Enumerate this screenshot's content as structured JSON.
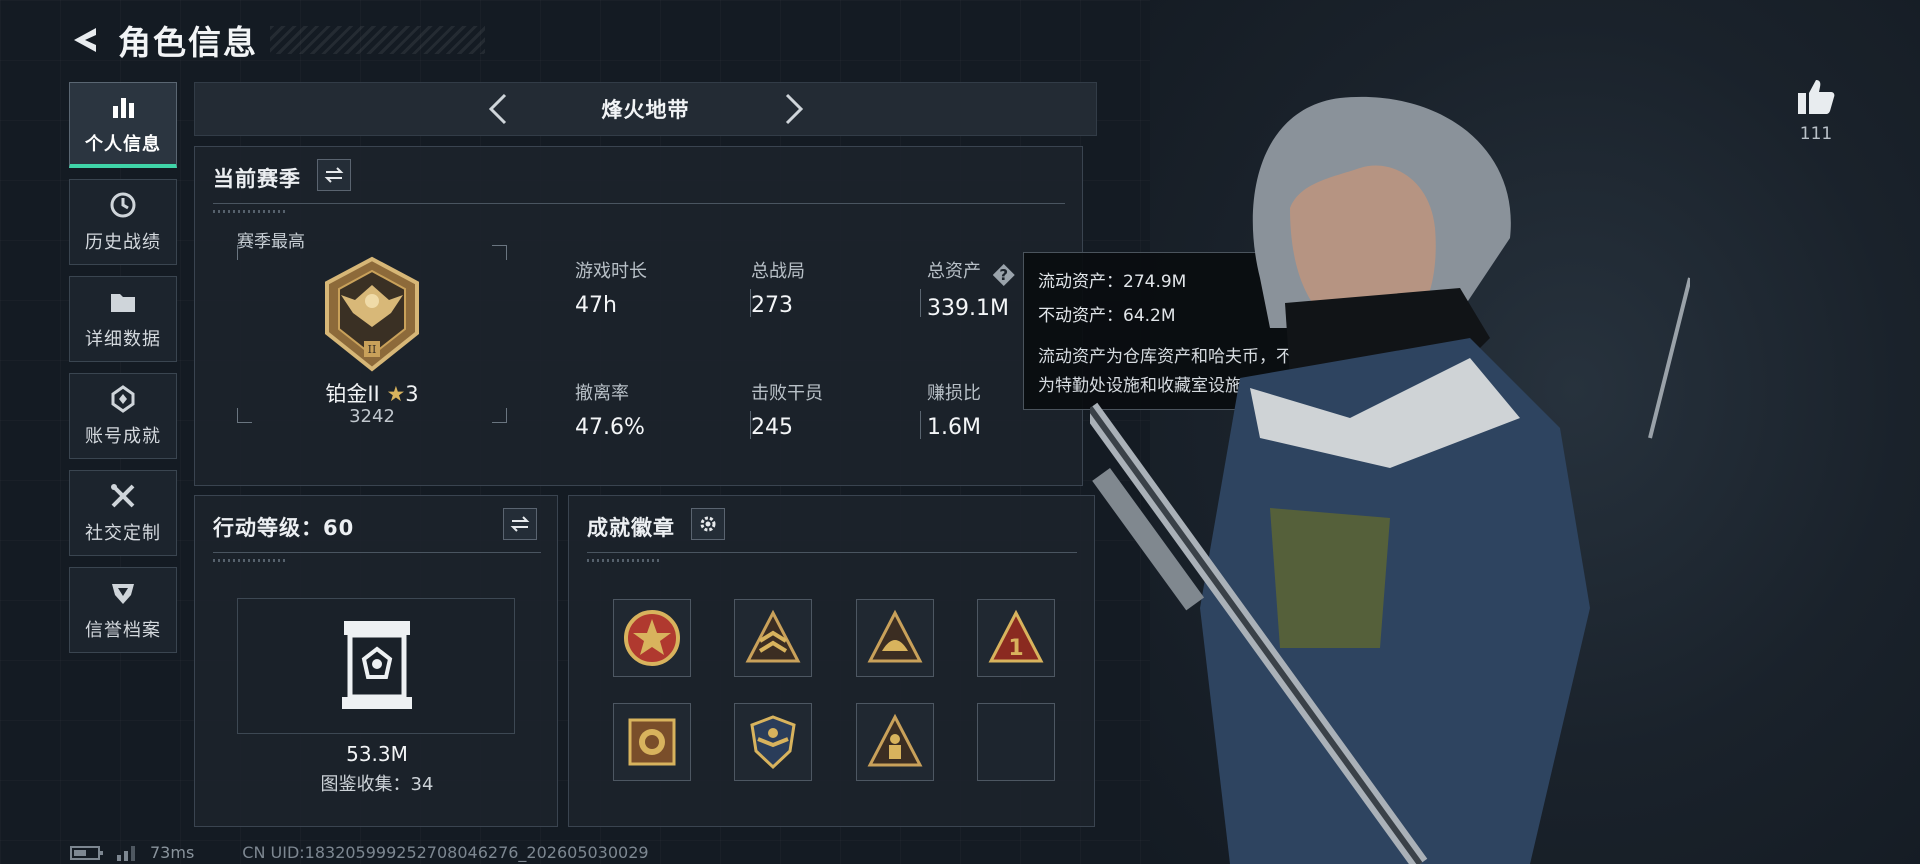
{
  "header": {
    "title": "角色信息"
  },
  "sidebar": {
    "items": [
      {
        "label": "个人信息",
        "icon": "bar-chart-icon",
        "active": true
      },
      {
        "label": "历史战绩",
        "icon": "history-icon",
        "active": false
      },
      {
        "label": "详细数据",
        "icon": "folder-icon",
        "active": false
      },
      {
        "label": "账号成就",
        "icon": "achievement-icon",
        "active": false
      },
      {
        "label": "社交定制",
        "icon": "tools-icon",
        "active": false
      },
      {
        "label": "信誉档案",
        "icon": "shield-icon",
        "active": false
      }
    ]
  },
  "mode_bar": {
    "label": "烽火地带"
  },
  "season": {
    "title": "当前赛季",
    "best_label": "赛季最高",
    "rank_name": "铂金II",
    "rank_stars": "3",
    "rank_score": "3242",
    "stats": [
      {
        "label": "游戏时长",
        "value": "47h"
      },
      {
        "label": "总战局",
        "value": "273"
      },
      {
        "label": "总资产",
        "value": "339.1M"
      },
      {
        "label": "撤离率",
        "value": "47.6%"
      },
      {
        "label": "击败干员",
        "value": "245"
      },
      {
        "label": "赚损比",
        "value": "1.6M"
      }
    ]
  },
  "tooltip": {
    "liquid": "流动资产：274.9M",
    "fixed": "不动资产：64.2M",
    "desc_line1": "流动资产为仓库资产和哈夫币，不动资产",
    "desc_line2": "为特勤处设施和收藏室设施"
  },
  "action_level": {
    "title": "行动等级：60",
    "value": "53.3M",
    "collection": "图鉴收集：34"
  },
  "badges": {
    "title": "成就徽章",
    "items": [
      "star-medal-badge",
      "rank-chevron-badge",
      "helmet-triangle-badge",
      "number-one-triangle-badge",
      "lion-shield-badge",
      "winged-crest-badge",
      "soldier-triangle-badge",
      "empty-slot"
    ]
  },
  "likes": {
    "count": "111"
  },
  "status": {
    "ping": "73ms",
    "uid": "CN UID:18320599925270804​6276_202605030029"
  },
  "colors": {
    "accent": "#3fd4a8",
    "gold": "#c9a15a",
    "panel": "#1c232b"
  }
}
